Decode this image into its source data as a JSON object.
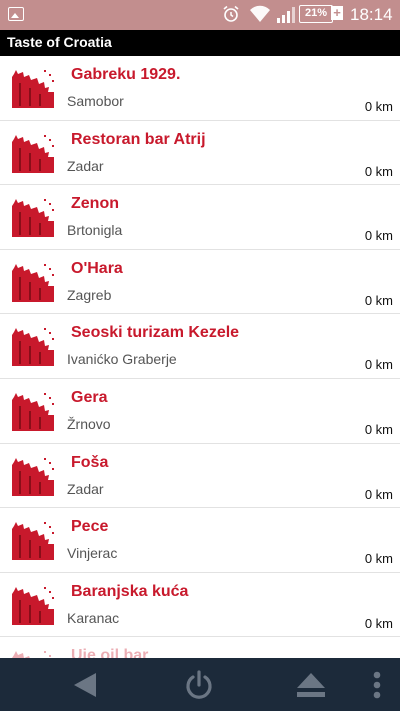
{
  "status_bar": {
    "battery_label": "21%",
    "time": "18:14"
  },
  "app": {
    "title": "Taste of Croatia"
  },
  "restaurants": [
    {
      "name": "Gabreku 1929.",
      "city": "Samobor",
      "distance": "0 km"
    },
    {
      "name": "Restoran bar Atrij",
      "city": "Zadar",
      "distance": "0 km"
    },
    {
      "name": "Zenon",
      "city": "Brtonigla",
      "distance": "0 km"
    },
    {
      "name": "O'Hara",
      "city": "Zagreb",
      "distance": "0 km"
    },
    {
      "name": "Seoski turizam Kezele",
      "city": "Ivanićko Graberje",
      "distance": "0 km"
    },
    {
      "name": "Gera",
      "city": "Žrnovo",
      "distance": "0 km"
    },
    {
      "name": "Foša",
      "city": "Zadar",
      "distance": "0 km"
    },
    {
      "name": "Pece",
      "city": "Vinjerac",
      "distance": "0 km"
    },
    {
      "name": "Baranjska kuća",
      "city": "Karanac",
      "distance": "0 km"
    },
    {
      "name": "Uje oil bar",
      "city": "",
      "distance": ""
    }
  ],
  "colors": {
    "status_bar": "#c28e8e",
    "title_bar": "#000000",
    "accent": "#c8192c",
    "nav_bar": "#1c2a3a"
  },
  "icons": {
    "logo": "restaurant-logo-icon",
    "back": "back-icon",
    "power": "power-icon",
    "eject": "eject-icon",
    "more": "more-vert-icon"
  }
}
